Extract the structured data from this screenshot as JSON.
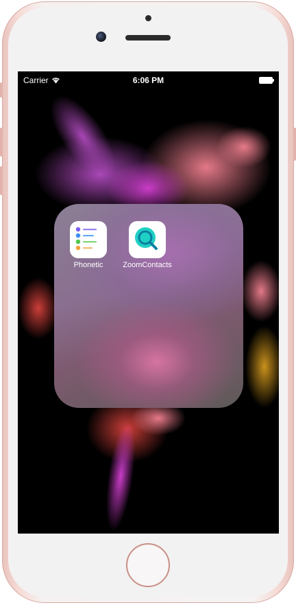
{
  "statusbar": {
    "carrier": "Carrier",
    "time": "6:06 PM",
    "wifi_icon": "wifi-icon",
    "battery_icon": "battery-icon",
    "battery_level": 1.0
  },
  "folder": {
    "apps": [
      {
        "label": "Phonetic",
        "icon": "phonetic-list-icon"
      },
      {
        "label": "ZoomContacts",
        "icon": "zoom-magnifier-icon"
      }
    ]
  },
  "colors": {
    "device_frame": "#e9c3bd",
    "zoom_accent": "#1fd0c4",
    "screen_bg": "#000000"
  }
}
